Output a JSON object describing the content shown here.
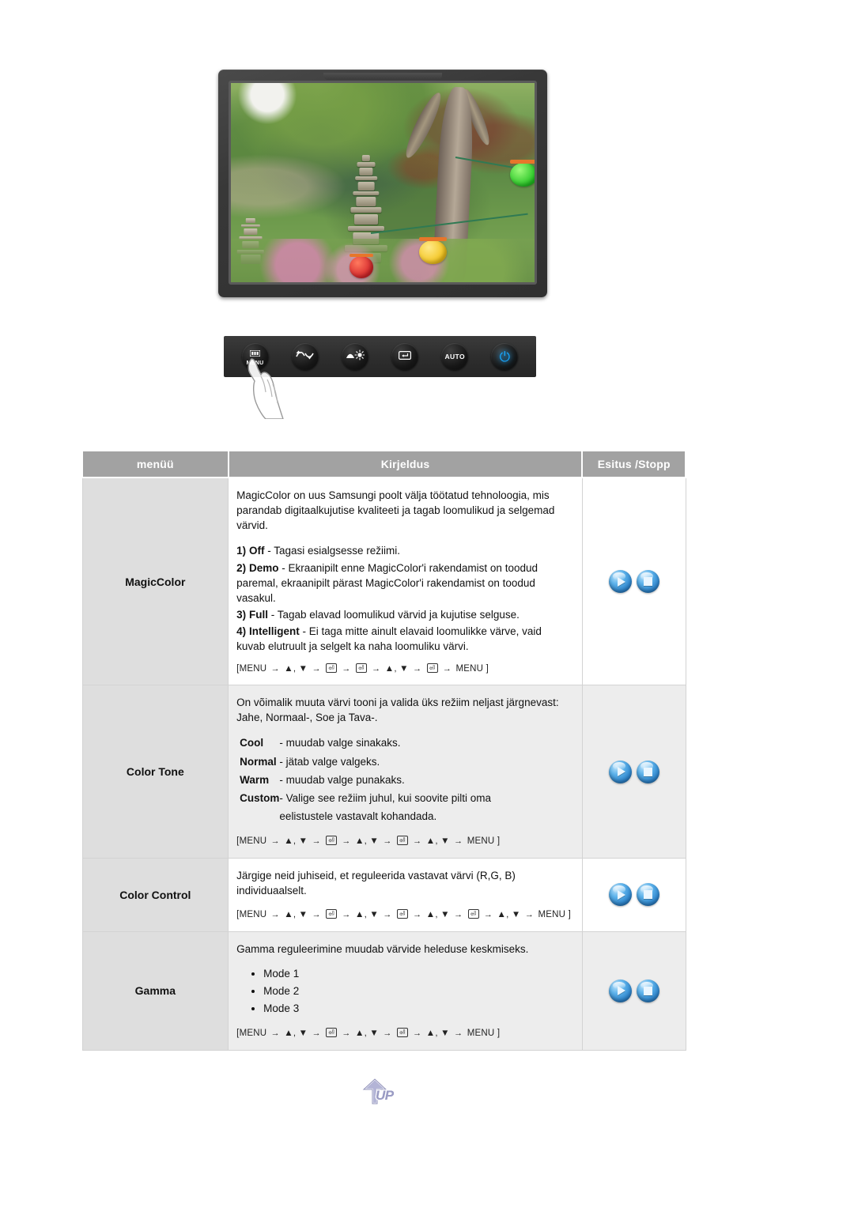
{
  "monitor": {
    "alt": "samsung-monitor-showing-korean-garden-photo",
    "scene": "garden-with-stone-pagoda-trees-and-paper-lanterns"
  },
  "control_bar": {
    "buttons": [
      {
        "name": "menu-button",
        "label": "MENU",
        "icon": "menu-grid-icon"
      },
      {
        "name": "updown-button",
        "label": "",
        "icon": "up-down-arrow-icon"
      },
      {
        "name": "brightness-button",
        "label": "",
        "icon": "brightness-sun-icon"
      },
      {
        "name": "enter-button",
        "label": "",
        "icon": "enter-key-icon"
      },
      {
        "name": "auto-button",
        "label": "AUTO",
        "icon": "auto-text-icon"
      },
      {
        "name": "power-button",
        "label": "",
        "icon": "power-icon"
      }
    ],
    "power_color": "#17a7ff",
    "cursor": "hand-pointing-at-menu-button"
  },
  "table": {
    "headers": {
      "menu": "menüü",
      "description": "Kirjeldus",
      "control": "Esitus /Stopp"
    },
    "header_bg": "#a2a2a2",
    "rows": [
      {
        "menu": "MagicColor",
        "shaded": false,
        "intro": "MagicColor on uus Samsungi poolt välja töötatud tehnoloogia, mis parandab digitaalkujutise kvaliteeti ja tagab loomulikud ja selgemad värvid.",
        "items": [
          {
            "num": "1)",
            "key": "Off",
            "text": "- Tagasi esialgsesse režiimi."
          },
          {
            "num": "2)",
            "key": "Demo",
            "text": "- Ekraanipilt enne MagicColor'i rakendamist on toodud paremal, ekraanipilt pärast MagicColor'i rakendamist on toodud vasakul."
          },
          {
            "num": "3)",
            "key": "Full",
            "text": "- Tagab elavad loomulikud värvid ja kujutise selguse."
          },
          {
            "num": "4)",
            "key": "Intelligent",
            "text": "- Ei taga mitte ainult elavaid loomulikke värve, vaid kuvab elutruult ja selgelt ka naha loomuliku värvi."
          }
        ],
        "path": [
          "MENU",
          "▲, ▼",
          "ENTER",
          "ENTER",
          "▲, ▼",
          "ENTER",
          "MENU"
        ],
        "controls": [
          "play-button",
          "stop-button"
        ]
      },
      {
        "menu": "Color Tone",
        "shaded": true,
        "intro": "On võimalik muuta värvi tooni ja valida üks režiim neljast järgnevast: Jahe, Normaal-, Soe ja Tava-.",
        "tone_rows": [
          {
            "key": "Cool",
            "text": "- muudab valge sinakaks."
          },
          {
            "key": "Normal",
            "text": "- jätab valge valgeks."
          },
          {
            "key": "Warm",
            "text": "- muudab valge punakaks."
          },
          {
            "key": "Custom",
            "text": "- Valige see režiim juhul, kui soovite pilti oma",
            "cont": "eelistustele vastavalt kohandada."
          }
        ],
        "path": [
          "MENU",
          "▲, ▼",
          "ENTER",
          "▲, ▼",
          "ENTER",
          "▲, ▼",
          "MENU"
        ],
        "controls": [
          "play-button",
          "stop-button"
        ]
      },
      {
        "menu": "Color Control",
        "shaded": false,
        "intro": "Järgige neid juhiseid, et reguleerida vastavat värvi (R,G, B) individuaalselt.",
        "path": [
          "MENU",
          "▲, ▼",
          "ENTER",
          "▲, ▼",
          "ENTER",
          "▲, ▼",
          "ENTER",
          "▲, ▼",
          "MENU"
        ],
        "controls": [
          "play-button",
          "stop-button"
        ]
      },
      {
        "menu": "Gamma",
        "shaded": true,
        "intro": "Gamma reguleerimine muudab värvide heleduse keskmiseks.",
        "modes": [
          "Mode 1",
          "Mode 2",
          "Mode 3"
        ],
        "path": [
          "MENU",
          "▲, ▼",
          "ENTER",
          "▲, ▼",
          "ENTER",
          "▲, ▼",
          "MENU"
        ],
        "controls": [
          "play-button",
          "stop-button"
        ]
      }
    ]
  },
  "up_button": {
    "label": "UP",
    "icon": "up-arrow-icon",
    "color": "#9b9cc4"
  }
}
